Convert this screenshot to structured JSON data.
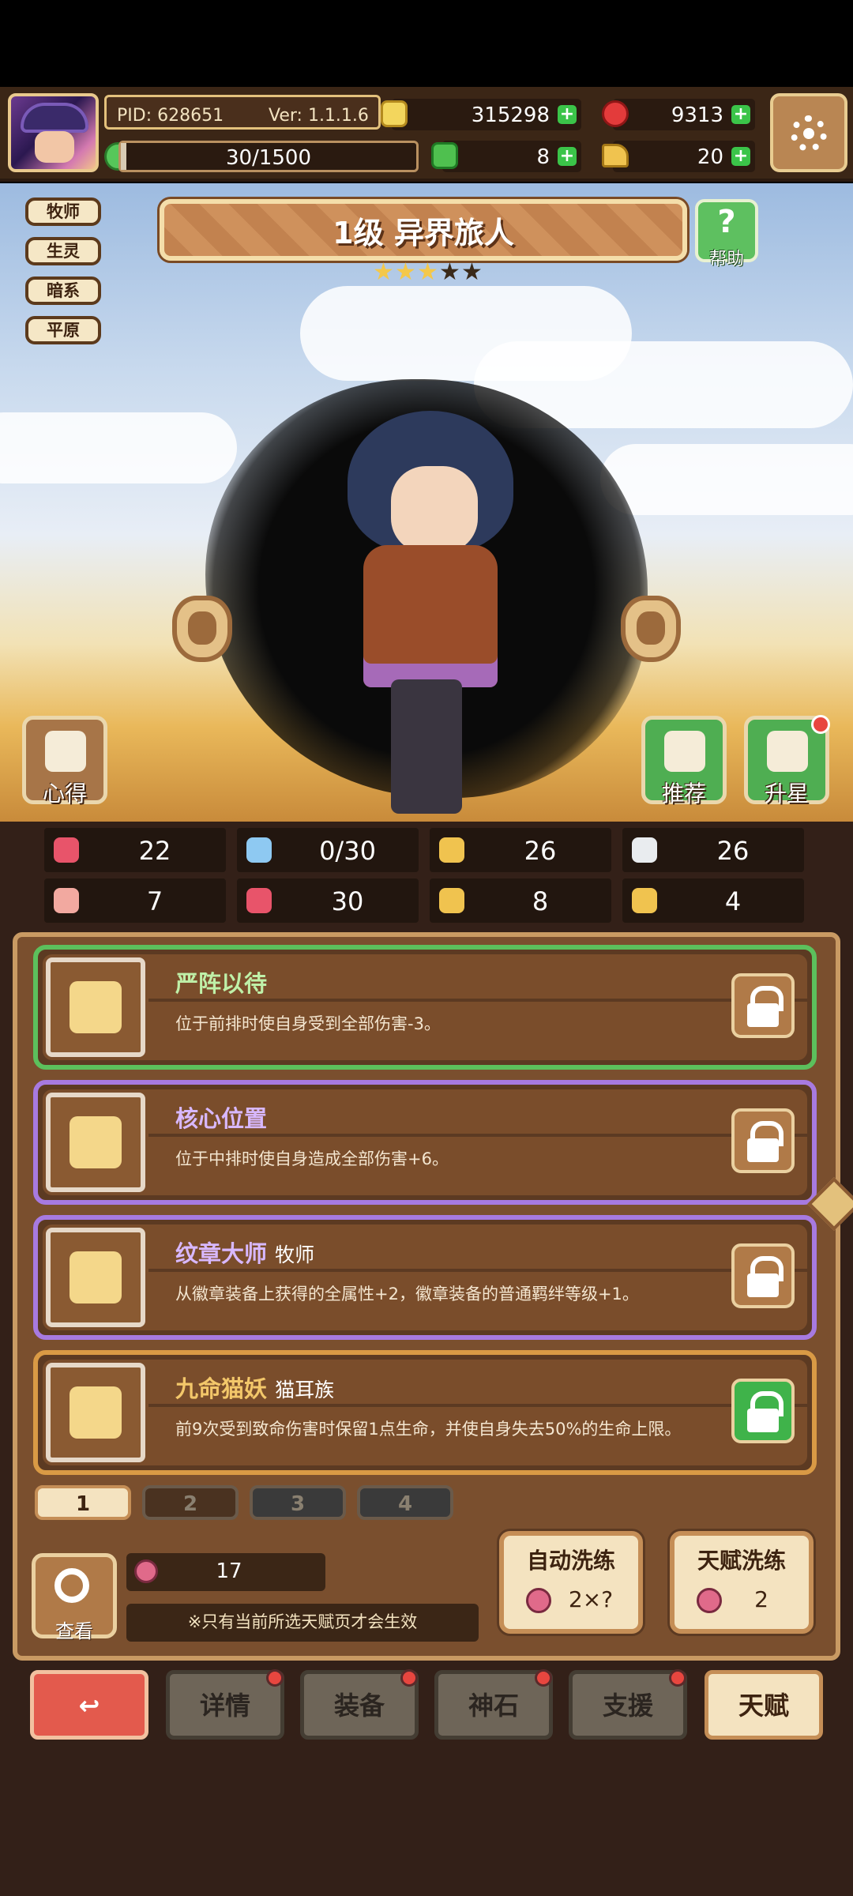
{
  "header": {
    "pid": "PID: 628651",
    "version": "Ver: 1.1.1.6",
    "gold": "315298",
    "gems": "9313",
    "stamina": "30/1500",
    "stamina_fraction": 0.02,
    "clovers": "8",
    "boots": "20"
  },
  "tags": [
    "牧师",
    "生灵",
    "暗系",
    "平原"
  ],
  "hero": {
    "title": "1级 异界旅人",
    "help_label": "帮助",
    "stars_filled": 3,
    "stars_total": 5
  },
  "side_buttons": {
    "insight_label": "心得",
    "recommend_label": "推荐",
    "upgrade_star_label": "升星"
  },
  "stats": [
    {
      "icon": "heart-icon",
      "value": "22",
      "color": "#e8546a"
    },
    {
      "icon": "mana-drop-icon",
      "value": "0/30",
      "color": "#8ec9f2"
    },
    {
      "icon": "shield-icon",
      "value": "26",
      "color": "#f0c34f"
    },
    {
      "icon": "wing-speed-icon",
      "value": "26",
      "color": "#e9ecef"
    },
    {
      "icon": "fist-attack-icon",
      "value": "7",
      "color": "#f2a9a0"
    },
    {
      "icon": "book-magic-icon",
      "value": "30",
      "color": "#e8546a"
    },
    {
      "icon": "boot-move-icon",
      "value": "8",
      "color": "#f0c34f"
    },
    {
      "icon": "horseshoe-luck-icon",
      "value": "4",
      "color": "#f0c34f"
    }
  ],
  "talents": [
    {
      "name": "严阵以待",
      "tag": "",
      "desc": "位于前排时使自身受到全部伤害-3。",
      "name_color": "#bff0a8",
      "border": "#5cc05c",
      "locked": false
    },
    {
      "name": "核心位置",
      "tag": "",
      "desc": "位于中排时使自身造成全部伤害+6。",
      "name_color": "#d8b8ff",
      "border": "#a77ae0",
      "locked": false
    },
    {
      "name": "纹章大师",
      "tag": "牧师",
      "desc": "从徽章装备上获得的全属性+2，徽章装备的普通羁绊等级+1。",
      "name_color": "#d8b8ff",
      "border": "#a77ae0",
      "locked": false
    },
    {
      "name": "九命猫妖",
      "tag": "猫耳族",
      "desc": "前9次受到致命伤害时保留1点生命，并使自身失去50%的生命上限。",
      "name_color": "#f3c76a",
      "border": "#d99a45",
      "locked": true
    }
  ],
  "pages": [
    "1",
    "2",
    "3",
    "4"
  ],
  "active_page": 0,
  "bottom": {
    "view_label": "查看",
    "fruit_count": "17",
    "notice": "※只有当前所选天赋页才会生效",
    "auto_wash_label": "自动洗练",
    "auto_wash_cost": "2×?",
    "talent_wash_label": "天赋洗练",
    "talent_wash_cost": "2"
  },
  "nav": {
    "details": "详情",
    "equipment": "装备",
    "godstone": "神石",
    "support": "支援",
    "talent": "天赋"
  }
}
